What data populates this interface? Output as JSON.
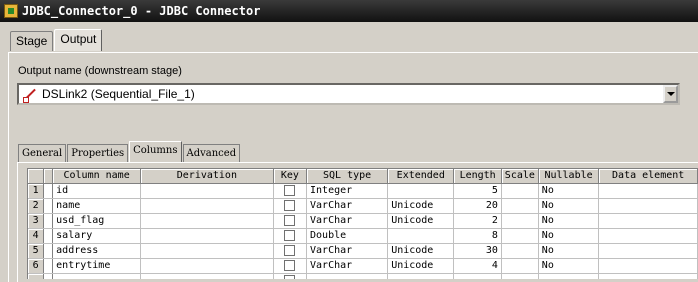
{
  "window": {
    "title": "JDBC_Connector_0 - JDBC Connector"
  },
  "outer_tabs": [
    {
      "label": "Stage",
      "active": false
    },
    {
      "label": "Output",
      "active": true
    }
  ],
  "output_name": {
    "label": "Output name (downstream stage)",
    "value": "DSLink2 (Sequential_File_1)"
  },
  "inner_tabs": [
    {
      "label": "General",
      "active": false
    },
    {
      "label": "Properties",
      "active": false
    },
    {
      "label": "Columns",
      "active": true
    },
    {
      "label": "Advanced",
      "active": false
    }
  ],
  "columns_grid": {
    "headers": [
      "Column name",
      "Derivation",
      "Key",
      "SQL type",
      "Extended",
      "Length",
      "Scale",
      "Nullable",
      "Data element"
    ],
    "rows": [
      {
        "num": "1",
        "name": "id",
        "derivation": "",
        "key": false,
        "sql_type": "Integer",
        "extended": "",
        "length": "5",
        "scale": "",
        "nullable": "No",
        "data_element": ""
      },
      {
        "num": "2",
        "name": "name",
        "derivation": "",
        "key": false,
        "sql_type": "VarChar",
        "extended": "Unicode",
        "length": "20",
        "scale": "",
        "nullable": "No",
        "data_element": ""
      },
      {
        "num": "3",
        "name": "usd_flag",
        "derivation": "",
        "key": false,
        "sql_type": "VarChar",
        "extended": "Unicode",
        "length": "2",
        "scale": "",
        "nullable": "No",
        "data_element": ""
      },
      {
        "num": "4",
        "name": "salary",
        "derivation": "",
        "key": false,
        "sql_type": "Double",
        "extended": "",
        "length": "8",
        "scale": "",
        "nullable": "No",
        "data_element": ""
      },
      {
        "num": "5",
        "name": "address",
        "derivation": "",
        "key": false,
        "sql_type": "VarChar",
        "extended": "Unicode",
        "length": "30",
        "scale": "",
        "nullable": "No",
        "data_element": ""
      },
      {
        "num": "6",
        "name": "entrytime",
        "derivation": "",
        "key": false,
        "sql_type": "VarChar",
        "extended": "Unicode",
        "length": "4",
        "scale": "",
        "nullable": "No",
        "data_element": ""
      }
    ]
  }
}
